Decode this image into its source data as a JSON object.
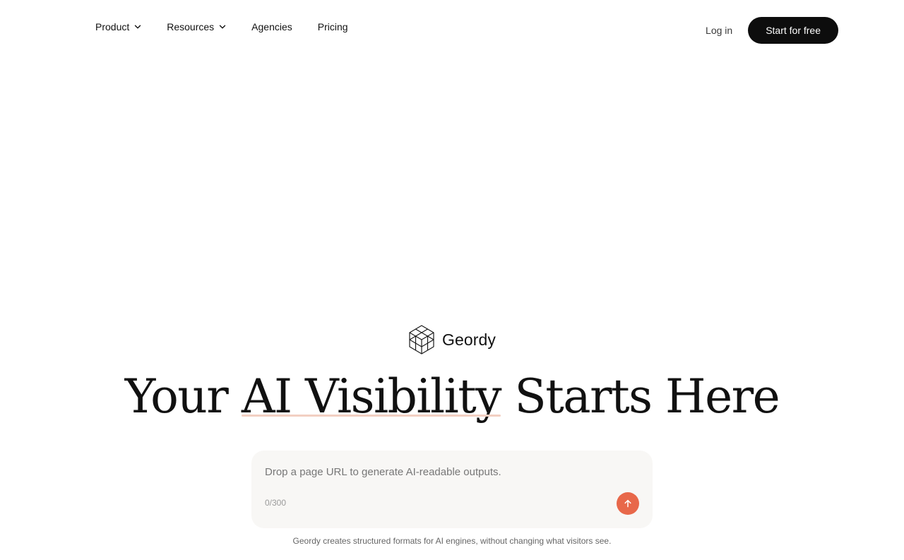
{
  "nav": {
    "items": [
      {
        "label": "Product",
        "has_dropdown": true,
        "icon": "chevron-down-icon"
      },
      {
        "label": "Resources",
        "has_dropdown": true,
        "icon": "chevron-down-icon"
      },
      {
        "label": "Agencies",
        "has_dropdown": false
      },
      {
        "label": "Pricing",
        "has_dropdown": false
      }
    ],
    "login_label": "Log in",
    "cta_label": "Start for free"
  },
  "brand": {
    "name": "Geordy",
    "logo_icon": "hexagon-cube-logo-icon"
  },
  "hero": {
    "headline_prefix": "Your ",
    "headline_highlight": "AI Visibility",
    "headline_suffix": " Starts Here"
  },
  "input": {
    "placeholder": "Drop a page URL to generate AI-readable outputs.",
    "value": "",
    "counter": "0/300",
    "submit_icon": "arrow-up-icon"
  },
  "caption": "Geordy creates structured formats for AI engines, without changing what visitors see.",
  "colors": {
    "cta_background": "#0d0d0d",
    "submit_accent": "#e8684a",
    "highlight_underline": "#f2cfc2",
    "card_background": "#f8f7f5"
  }
}
